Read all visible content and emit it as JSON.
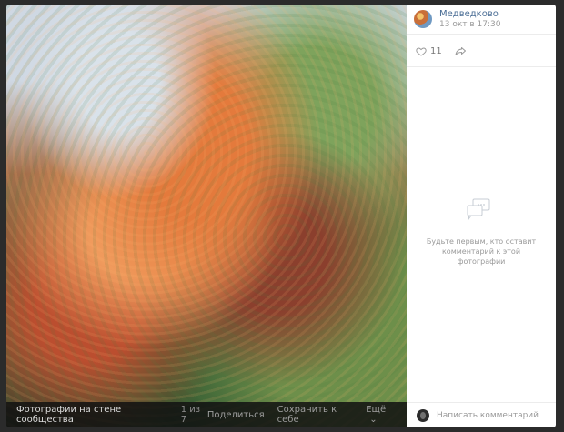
{
  "header": {
    "author": "Медведково",
    "timestamp": "13 окт в 17:30"
  },
  "stats": {
    "likes": "11"
  },
  "empty_state": {
    "message": "Будьте первым, кто оставит комментарий к этой фотографии"
  },
  "bottom_bar": {
    "album_title": "Фотографии на стене сообщества",
    "counter": "1 из 7",
    "share": "Поделиться",
    "save": "Сохранить к себе",
    "more": "Ещё"
  },
  "composer": {
    "placeholder": "Написать комментарий..."
  },
  "icons": {
    "like": "heart-icon",
    "share": "share-arrow-icon",
    "comments": "comment-bubble-icon",
    "more": "chevron-down-icon"
  },
  "colors": {
    "background": "#2b2b2b",
    "panel": "#ffffff",
    "accent": "#4a6d95"
  }
}
